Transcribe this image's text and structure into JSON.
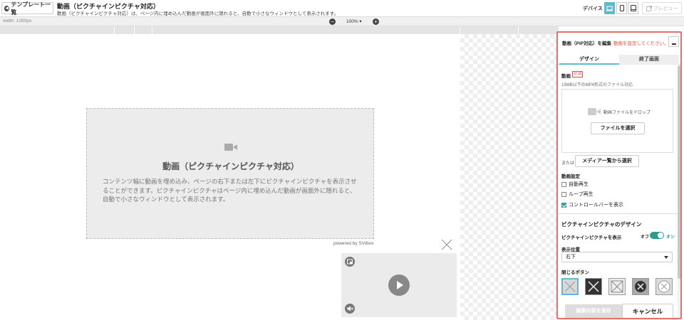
{
  "header": {
    "back_label": "テンプレート一覧",
    "title": "動画（ピクチャインピクチャ対応）",
    "subtitle": "動画（ピクチャインピクチャ対応）は、ページ内に埋め込んだ動画が画面外に隠れると、自動で小さなウィンドウとして表示されます。",
    "device_label": "デバイス",
    "device_selected": "desktop",
    "preview_label": "プレビュー"
  },
  "toolbar": {
    "width_label": "width: 1280px",
    "zoom_value": "100% ▾",
    "zoom_minus": "−",
    "zoom_plus": "+"
  },
  "canvas": {
    "placeholder_title": "動画（ピクチャインピクチャ対応）",
    "placeholder_desc": "コンテンツ幅に動画を埋め込み、ページの右下または左下にピクチャインピクチャを表示させることができます。ピクチャインピクチャはページ内に埋め込んだ動画が画面外に隠れると、自動で小さなウィンドウとして表示されます。",
    "powered_by": "powered by SVIbox"
  },
  "panel": {
    "title": "動画（PiP対応）を編集",
    "warning": "動画を設定してください。",
    "tabs": [
      {
        "label": "デザイン",
        "active": true
      },
      {
        "label": "終了画面",
        "active": false
      }
    ],
    "video_label": "動画",
    "required_badge": "必須",
    "video_hint": "15MB以下のMP4形式のファイル対応",
    "drop_text": "動画ファイルをドロップ",
    "file_button": "ファイルを選択",
    "or_text": "または",
    "media_button": "メディア一覧から選択",
    "video_settings_label": "動画設定",
    "settings": [
      {
        "label": "自動再生",
        "checked": false
      },
      {
        "label": "ループ再生",
        "checked": false
      },
      {
        "label": "コントロールバーを表示",
        "checked": true
      }
    ],
    "pip_design_label": "ピクチャインピクチャのデザイン",
    "pip_show_label": "ピクチャインピクチャを表示",
    "toggle_off": "オフ",
    "toggle_on": "オン",
    "toggle_state": "on",
    "position_label": "表示位置",
    "position_value": "右下",
    "close_button_label": "閉じるボタン",
    "close_styles": [
      "x-light-selected",
      "x-dark-square",
      "x-outline-square",
      "x-dark-circle",
      "x-light-circle"
    ],
    "save_button": "編集内容を保存",
    "cancel_button": "キャンセル"
  },
  "colors": {
    "accent": "#5fb9cf",
    "panel_border": "#e8706a",
    "toggle_on": "#2a9d8f",
    "warning": "#e74c3c"
  }
}
